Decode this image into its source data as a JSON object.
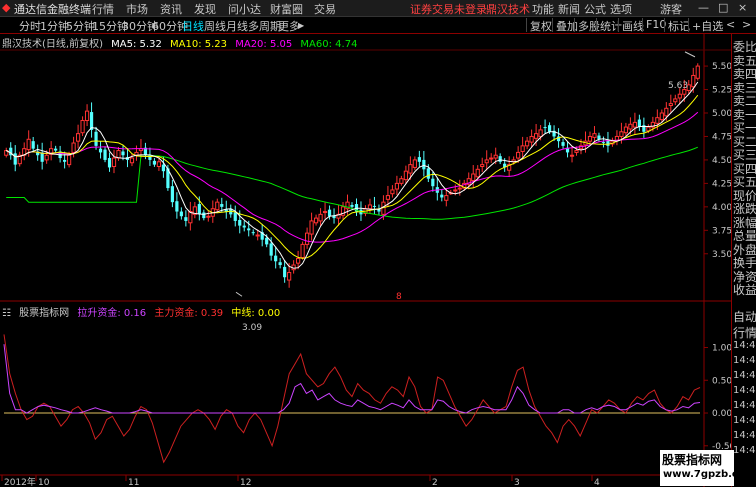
{
  "titlebar": {
    "app_title": "通达信金融终端",
    "menu": [
      "行情",
      "市场",
      "资讯",
      "发现",
      "问小达",
      "财富圈",
      "交易"
    ],
    "notice": "证券交易未登录",
    "stock_title": "鼎汉技术",
    "right_menu": [
      "功能",
      "新闻",
      "公式",
      "选项"
    ],
    "user": "游客",
    "window_buttons": [
      "—",
      "□",
      "×"
    ]
  },
  "toolbar": {
    "periods": [
      "分时",
      "1分钟",
      "5分钟",
      "15分钟",
      "30分钟",
      "60分钟",
      "日线",
      "周线",
      "月线",
      "多周期",
      "更多"
    ],
    "active_period": "日线",
    "right_buttons": [
      "复权",
      "叠加",
      "多股",
      "统计",
      "画线",
      "F10",
      "标记",
      "+自选"
    ],
    "nav_arrows": [
      "<",
      ">"
    ]
  },
  "main_chart": {
    "title": "鼎汉技术(日线,前复权)",
    "ma5": "MA5: 5.32",
    "ma10": "MA10: 5.23",
    "ma20": "MA20: 5.05",
    "ma60": "MA60: 4.74",
    "high_label": "5.63",
    "low_label": "3.09",
    "volume_marker": "8",
    "y_ticks": [
      "5.50",
      "5.25",
      "5.00",
      "4.75",
      "4.50",
      "4.25",
      "4.00",
      "3.75",
      "3.50"
    ]
  },
  "indicator": {
    "name": "股票指标网",
    "line1": "拉升资金: 0.16",
    "line2": "主力资金: 0.39",
    "line3": "中线: 0.00",
    "y_ticks": [
      "1.00",
      "0.50",
      "0.00",
      "-0.50"
    ]
  },
  "x_axis": [
    "2012年",
    "10",
    "11",
    "12",
    "2",
    "3",
    "4"
  ],
  "sidebar": {
    "quote_items": [
      "委比",
      "卖五",
      "卖四",
      "卖三",
      "卖二",
      "卖一",
      "买一",
      "买二",
      "买三",
      "买四",
      "买五",
      "现价",
      "涨跌",
      "涨幅",
      "总量",
      "外盘",
      "换手",
      "净资",
      "收益"
    ],
    "auto_label": "自动",
    "quote_label": "行情",
    "times": [
      "14:4",
      "14:4",
      "14:4",
      "14:4",
      "14:4",
      "14:4",
      "14:4",
      "14:4"
    ]
  },
  "watermark": {
    "line1": "股票指标网",
    "line2": "www.7gpzb.com"
  },
  "colors": {
    "up": "#ff3232",
    "down": "#54ffff",
    "ma5": "#ffffff",
    "ma10": "#ffff00",
    "ma20": "#ff00ff",
    "ma60": "#00e600",
    "main_line": "#cc2020",
    "second_line": "#cc44ff",
    "zero_line": "#e0c060",
    "border": "#8b0000"
  },
  "chart_data": [
    {
      "type": "candlestick",
      "title": "鼎汉技术(日线,前复权)",
      "y_range": [
        3.05,
        5.65
      ],
      "x_labels": [
        "2012年",
        "10",
        "11",
        "12",
        "2",
        "3",
        "4"
      ],
      "close": [
        4.6,
        4.55,
        4.45,
        4.55,
        4.62,
        4.72,
        4.62,
        4.55,
        4.48,
        4.55,
        4.62,
        4.6,
        4.52,
        4.48,
        4.55,
        4.68,
        4.78,
        4.92,
        5.02,
        4.82,
        4.65,
        4.58,
        4.5,
        4.42,
        4.52,
        4.6,
        4.55,
        4.5,
        4.52,
        4.58,
        4.62,
        4.55,
        4.5,
        4.45,
        4.48,
        4.38,
        4.2,
        4.05,
        3.95,
        3.9,
        3.85,
        3.95,
        4.0,
        3.92,
        3.88,
        3.9,
        3.98,
        4.05,
        4.0,
        3.95,
        3.92,
        3.85,
        3.8,
        3.78,
        3.75,
        3.72,
        3.7,
        3.65,
        3.6,
        3.48,
        3.42,
        3.38,
        3.25,
        3.3,
        3.38,
        3.45,
        3.6,
        3.72,
        3.85,
        3.88,
        3.92,
        3.95,
        3.9,
        3.88,
        3.92,
        4.0,
        4.05,
        4.0,
        3.95,
        3.92,
        3.98,
        4.02,
        4.0,
        3.95,
        4.05,
        4.12,
        4.18,
        4.25,
        4.3,
        4.38,
        4.45,
        4.5,
        4.48,
        4.4,
        4.3,
        4.22,
        4.15,
        4.1,
        4.12,
        4.15,
        4.18,
        4.2,
        4.25,
        4.3,
        4.35,
        4.4,
        4.45,
        4.5,
        4.52,
        4.55,
        4.48,
        4.42,
        4.45,
        4.5,
        4.58,
        4.65,
        4.7,
        4.75,
        4.78,
        4.82,
        4.85,
        4.8,
        4.75,
        4.7,
        4.65,
        4.58,
        4.55,
        4.6,
        4.65,
        4.7,
        4.75,
        4.78,
        4.72,
        4.68,
        4.65,
        4.7,
        4.75,
        4.8,
        4.85,
        4.88,
        4.9,
        4.85,
        4.8,
        4.85,
        4.9,
        4.95,
        5.0,
        5.05,
        5.1,
        5.15,
        5.2,
        5.25,
        5.3,
        5.4,
        5.5
      ]
    },
    {
      "type": "line",
      "title": "股票指标网",
      "y_range": [
        -0.9,
        1.45
      ],
      "series": [
        {
          "name": "拉升资金",
          "values": [
            1.05,
            0.3,
            0.05,
            0.05,
            0.0,
            0.05,
            0.1,
            0.12,
            0.1,
            0.08,
            0.05,
            0.03,
            0.0,
            0.0,
            0.02,
            0.05,
            0.08,
            0.05,
            0.03,
            0.0,
            0.0,
            0.0,
            0.0,
            0.02,
            0.05,
            0.03,
            0.0,
            0.0,
            0.0,
            0.0,
            0.0,
            0.0,
            0.0,
            0.0,
            0.0,
            0.0,
            0.0,
            0.0,
            0.0,
            0.0,
            0.0,
            0.0,
            0.0,
            0.0,
            0.0,
            0.0,
            0.0,
            0.0,
            0.0,
            0.05,
            0.15,
            0.4,
            0.45,
            0.3,
            0.35,
            0.2,
            0.25,
            0.3,
            0.2,
            0.15,
            0.12,
            0.1,
            0.2,
            0.15,
            0.1,
            0.08,
            0.05,
            0.1,
            0.15,
            0.12,
            0.08,
            0.2,
            0.1,
            0.05,
            0.05,
            0.05,
            0.2,
            0.18,
            0.1,
            0.05,
            0.02,
            0.0,
            0.05,
            0.08,
            0.1,
            0.08,
            0.05,
            0.05,
            0.05,
            0.2,
            0.4,
            0.3,
            0.12,
            0.05,
            0.0,
            0.0,
            0.0,
            0.0,
            0.05,
            0.05,
            0.0,
            0.0,
            0.05,
            0.08,
            0.05,
            0.1,
            0.12,
            0.1,
            0.05,
            0.05,
            0.1,
            0.15,
            0.12,
            0.18,
            0.2,
            0.1,
            0.05,
            0.03,
            0.05,
            0.1,
            0.08,
            0.15,
            0.16
          ]
        },
        {
          "name": "主力资金",
          "values": [
            1.2,
            0.6,
            0.3,
            0.05,
            -0.1,
            -0.05,
            0.1,
            0.15,
            0.1,
            -0.05,
            -0.2,
            -0.1,
            0.05,
            0.1,
            0.0,
            -0.15,
            -0.4,
            -0.3,
            -0.1,
            -0.05,
            -0.2,
            -0.35,
            -0.25,
            -0.05,
            0.1,
            0.05,
            -0.15,
            -0.45,
            -0.75,
            -0.6,
            -0.4,
            -0.2,
            -0.1,
            0.0,
            0.05,
            0.0,
            -0.1,
            -0.25,
            -0.05,
            0.05,
            0.0,
            -0.2,
            -0.3,
            -0.1,
            0.0,
            -0.1,
            -0.3,
            -0.5,
            -0.2,
            0.2,
            0.6,
            0.75,
            0.9,
            0.6,
            0.5,
            0.4,
            0.45,
            0.6,
            0.7,
            0.55,
            0.35,
            0.25,
            0.45,
            0.35,
            0.3,
            0.2,
            0.15,
            0.3,
            0.4,
            0.35,
            0.25,
            0.55,
            0.4,
            0.1,
            0.0,
            0.05,
            0.55,
            0.5,
            0.3,
            0.1,
            -0.05,
            -0.2,
            -0.1,
            0.05,
            0.2,
            0.1,
            0.0,
            0.05,
            0.1,
            0.4,
            0.65,
            0.7,
            0.35,
            0.1,
            -0.05,
            -0.2,
            -0.3,
            -0.45,
            -0.2,
            -0.1,
            -0.2,
            -0.35,
            -0.15,
            0.05,
            0.0,
            0.1,
            0.2,
            0.15,
            0.05,
            0.0,
            0.15,
            0.25,
            0.2,
            0.3,
            0.35,
            0.15,
            0.05,
            0.0,
            0.1,
            0.25,
            0.2,
            0.35,
            0.39
          ]
        },
        {
          "name": "中线",
          "values": [
            0.0,
            0.0
          ]
        }
      ]
    }
  ]
}
